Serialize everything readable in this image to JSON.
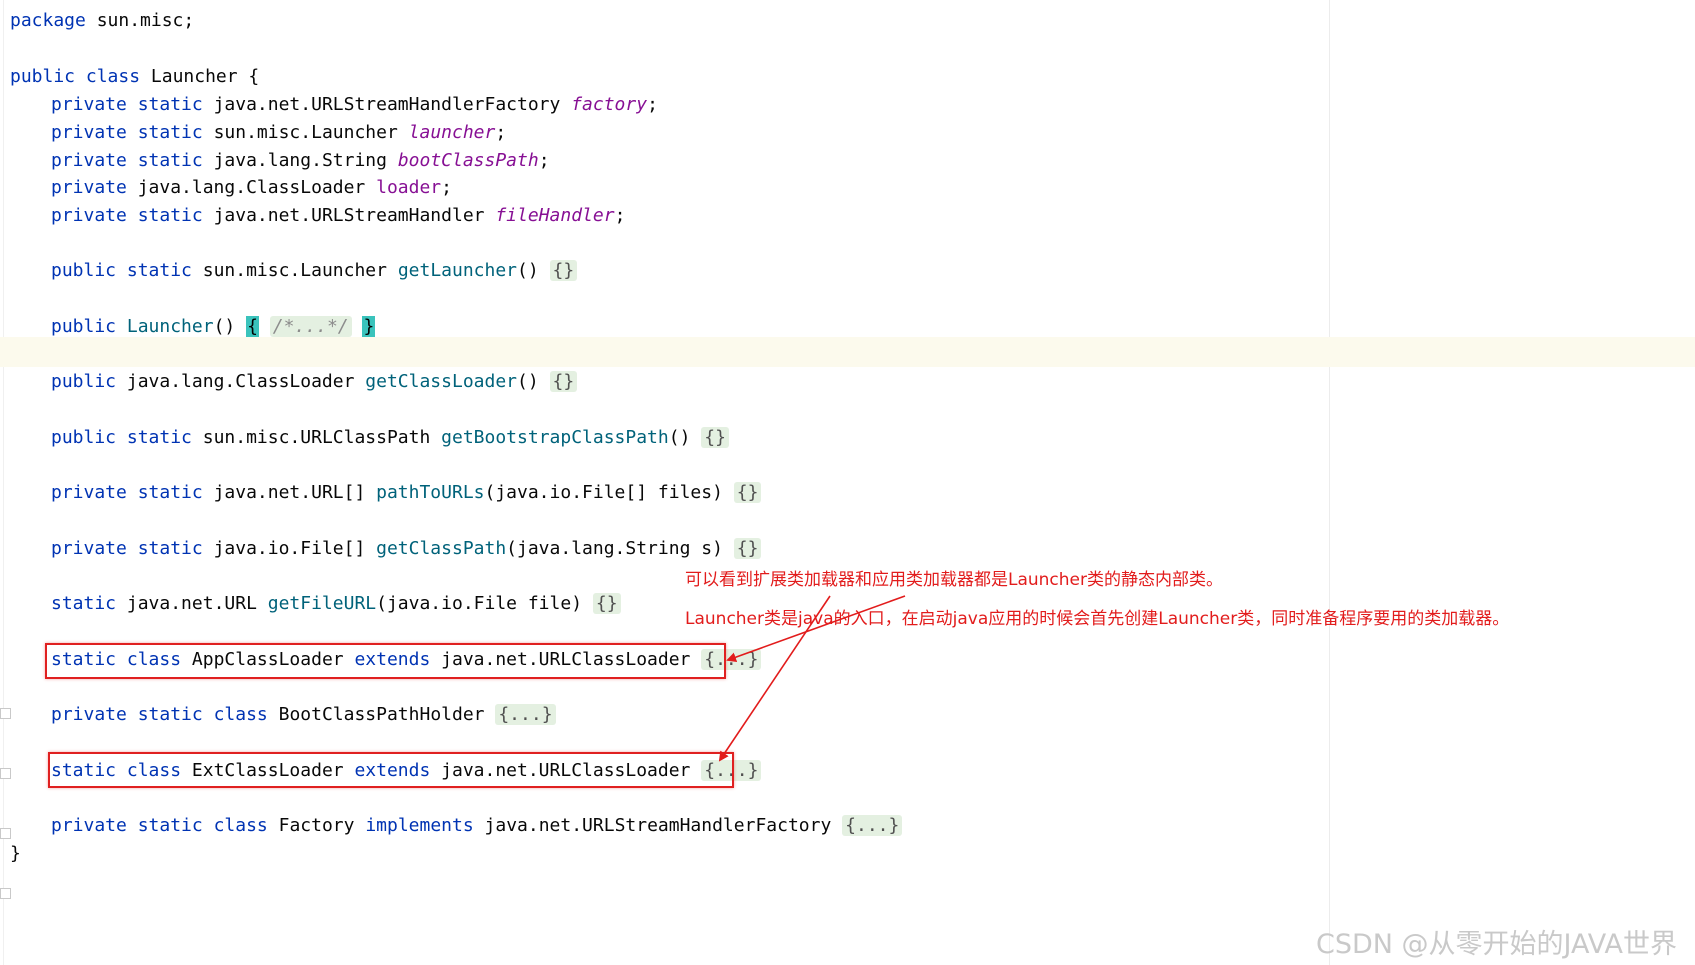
{
  "code": {
    "line1": {
      "kw": "package",
      "rest": " sun.misc;"
    },
    "line3": {
      "kw1": "public",
      "kw2": "class",
      "name": " Launcher {"
    },
    "fields": [
      {
        "kw1": "private",
        "kw2": "static",
        "type": " java.net.URLStreamHandlerFactory ",
        "name": "factory",
        "end": ";"
      },
      {
        "kw1": "private",
        "kw2": "static",
        "type": " sun.misc.Launcher ",
        "name": "launcher",
        "end": ";"
      },
      {
        "kw1": "private",
        "kw2": "static",
        "type": " java.lang.String ",
        "name": "bootClassPath",
        "end": ";"
      },
      {
        "kw1": "private",
        "kw2": "",
        "type": " java.lang.ClassLoader ",
        "name": "loader",
        "end": ";"
      },
      {
        "kw1": "private",
        "kw2": "static",
        "type": " java.net.URLStreamHandler ",
        "name": "fileHandler",
        "end": ";"
      }
    ],
    "getLauncher": {
      "kw1": "public",
      "kw2": "static",
      "type": " sun.misc.Launcher ",
      "method": "getLauncher",
      "params": "() ",
      "fold": "{}"
    },
    "constructor": {
      "kw1": "public",
      "method": "Launcher",
      "params": "() ",
      "open": "{",
      "comment": "/*...*/",
      "close": "}"
    },
    "getClassLoader": {
      "kw1": "public",
      "type": " java.lang.ClassLoader ",
      "method": "getClassLoader",
      "params": "() ",
      "fold": "{}"
    },
    "getBootstrapClassPath": {
      "kw1": "public",
      "kw2": "static",
      "type": " sun.misc.URLClassPath ",
      "method": "getBootstrapClassPath",
      "params": "() ",
      "fold": "{}"
    },
    "pathToURLs": {
      "kw1": "private",
      "kw2": "static",
      "type": " java.net.URL[] ",
      "method": "pathToURLs",
      "params": "(java.io.File[] files) ",
      "fold": "{}"
    },
    "getClassPath": {
      "kw1": "private",
      "kw2": "static",
      "type": " java.io.File[] ",
      "method": "getClassPath",
      "params": "(java.lang.String s) ",
      "fold": "{}"
    },
    "getFileURL": {
      "kw1": "static",
      "type": " java.net.URL ",
      "method": "getFileURL",
      "params": "(java.io.File file) ",
      "fold": "{}"
    },
    "appClassLoader": {
      "kw1": "static",
      "kw2": "class",
      "name": " AppClassLoader ",
      "kw3": "extends",
      "rest": " java.net.URLClassLoader ",
      "fold": "{...}"
    },
    "bootClassPathHolder": {
      "kw1": "private",
      "kw2": "static",
      "kw3": "class",
      "name": " BootClassPathHolder ",
      "fold": "{...}"
    },
    "extClassLoader": {
      "kw1": "static",
      "kw2": "class",
      "name": " ExtClassLoader ",
      "kw3": "extends",
      "rest": " java.net.URLClassLoader ",
      "fold": "{...}"
    },
    "factory": {
      "kw1": "private",
      "kw2": "static",
      "kw3": "class",
      "name": " Factory ",
      "kw4": "implements",
      "rest": " java.net.URLStreamHandlerFactory ",
      "fold": "{...}"
    },
    "closing": "}"
  },
  "annotations": {
    "note1": "可以看到扩展类加载器和应用类加载器都是Launcher类的静态内部类。",
    "note2": "Launcher类是java的入口，在启动java应用的时候会首先创建Launcher类，同时准备程序要用的类加载器。",
    "color": "#e21c1c"
  },
  "watermark": "CSDN @从零开始的JAVA世界"
}
